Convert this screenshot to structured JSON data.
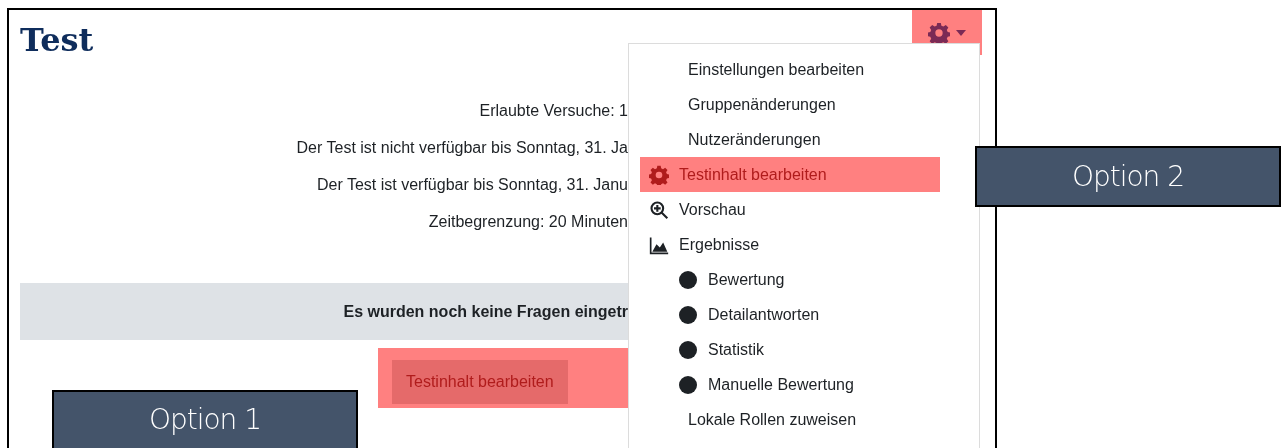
{
  "page": {
    "title": "Test",
    "info_lines": [
      "Erlaubte Versuche: 1",
      "Der Test ist nicht verfügbar bis Sonntag, 31. Ja",
      "Der Test ist verfügbar bis Sonntag, 31. Janu",
      "Zeitbegrenzung: 20 Minuten"
    ],
    "notice": "Es wurden noch keine Fragen eingetr",
    "edit_button": {
      "label": "Testinhalt bearbeiten",
      "highlighted": true
    }
  },
  "settings_menu": {
    "trigger_highlighted": true,
    "items": [
      {
        "kind": "text",
        "label": "Einstellungen bearbeiten",
        "highlighted": false
      },
      {
        "kind": "text",
        "label": "Gruppenänderungen",
        "highlighted": false
      },
      {
        "kind": "text",
        "label": "Nutzeränderungen",
        "highlighted": false
      },
      {
        "kind": "gear",
        "label": "Testinhalt bearbeiten",
        "highlighted": true
      },
      {
        "kind": "zoom",
        "label": "Vorschau",
        "highlighted": false
      },
      {
        "kind": "chart",
        "label": "Ergebnisse",
        "highlighted": false
      },
      {
        "kind": "bullet",
        "label": "Bewertung",
        "highlighted": false
      },
      {
        "kind": "bullet",
        "label": "Detailantworten",
        "highlighted": false
      },
      {
        "kind": "bullet",
        "label": "Statistik",
        "highlighted": false
      },
      {
        "kind": "bullet",
        "label": "Manuelle Bewertung",
        "highlighted": false
      },
      {
        "kind": "text",
        "label": "Lokale Rollen zuweisen",
        "highlighted": false
      }
    ]
  },
  "callouts": [
    {
      "label": "Option 1"
    },
    {
      "label": "Option 2"
    }
  ]
}
